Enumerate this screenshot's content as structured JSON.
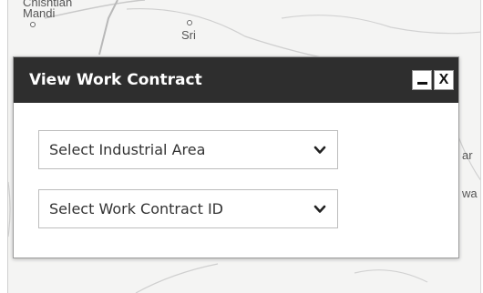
{
  "map": {
    "labels": {
      "chishtian": "Chishtian",
      "mandi": "Mandi",
      "sri": "Sri",
      "ar": "ar",
      "wa": "wa"
    },
    "colors": {
      "background": "#f4f4f3",
      "lines": "#c9c9c9"
    }
  },
  "dialog": {
    "title": "View Work Contract",
    "minimize_icon": "minus-icon",
    "close_label": "X",
    "colors": {
      "header": "#2e2e2e",
      "title": "#ffffff"
    }
  },
  "selects": {
    "industrial_area": {
      "selected": "Select Industrial Area",
      "icon": "chevron-down-icon"
    },
    "work_contract": {
      "selected": "Select Work Contract ID",
      "icon": "chevron-down-icon"
    }
  }
}
